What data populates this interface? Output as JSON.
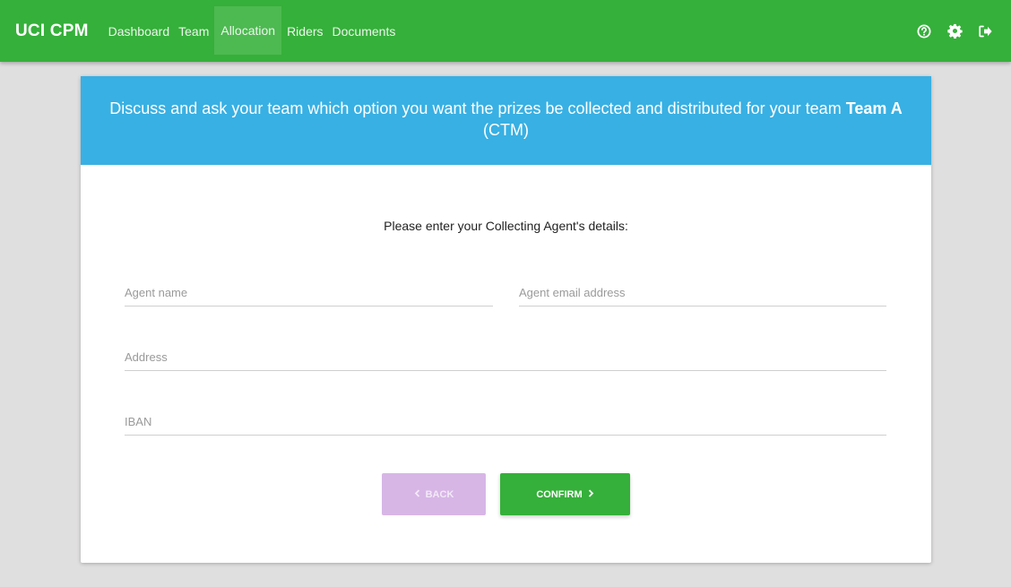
{
  "app": {
    "brand": "UCI CPM"
  },
  "nav": {
    "items": [
      {
        "label": "Dashboard"
      },
      {
        "label": "Team"
      },
      {
        "label": "Allocation"
      },
      {
        "label": "Riders"
      },
      {
        "label": "Documents"
      }
    ],
    "active": "Allocation"
  },
  "top_icons": [
    "help-icon",
    "settings-gear-icon",
    "logout-icon"
  ],
  "header": {
    "line_prefix": "Discuss and ask your team which option you want the prizes be collected and distributed for your team ",
    "team_name": "Team A",
    "team_code": " (CTM)"
  },
  "form": {
    "subtitle": "Please enter your Collecting Agent's details:",
    "agent_name": {
      "placeholder": "Agent name",
      "value": ""
    },
    "agent_email": {
      "placeholder": "Agent email address",
      "value": ""
    },
    "address": {
      "placeholder": "Address",
      "value": ""
    },
    "iban": {
      "placeholder": "IBAN",
      "value": ""
    }
  },
  "buttons": {
    "back_label": "BACK",
    "confirm_label": "CONFIRM"
  },
  "colors": {
    "topbar": "#35b03a",
    "header": "#38b0e3",
    "back_button": "#d7b6e6",
    "confirm_button": "#35b03a",
    "background": "#e0dfdf"
  }
}
